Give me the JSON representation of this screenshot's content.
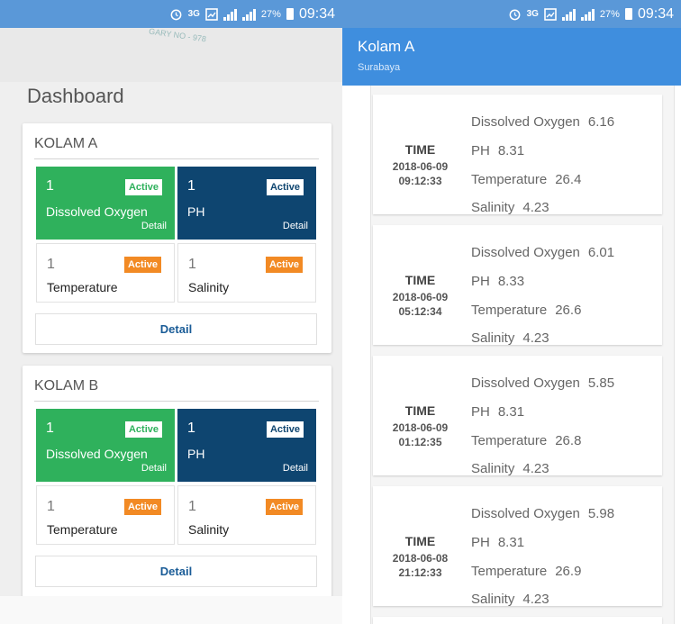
{
  "status_bar": {
    "left": {
      "network": "3G",
      "battery": "27%",
      "time": "09:34"
    },
    "right": {
      "network": "3G",
      "battery": "27%",
      "time": "09:34"
    }
  },
  "left_screen": {
    "watermark": "GARY NO - 978",
    "dashboard_title": "Dashboard",
    "ponds": [
      {
        "name": "KOLAM A",
        "tiles": [
          {
            "count": "1",
            "badge": "Active",
            "label": "Dissolved Oxygen",
            "detail": "Detail"
          },
          {
            "count": "1",
            "badge": "Active",
            "label": "PH",
            "detail": "Detail"
          },
          {
            "count": "1",
            "badge": "Active",
            "label": "Temperature"
          },
          {
            "count": "1",
            "badge": "Active",
            "label": "Salinity"
          }
        ],
        "detail_button": "Detail"
      },
      {
        "name": "KOLAM B",
        "tiles": [
          {
            "count": "1",
            "badge": "Active",
            "label": "Dissolved Oxygen",
            "detail": "Detail"
          },
          {
            "count": "1",
            "badge": "Active",
            "label": "PH",
            "detail": "Detail"
          },
          {
            "count": "1",
            "badge": "Active",
            "label": "Temperature"
          },
          {
            "count": "1",
            "badge": "Active",
            "label": "Salinity"
          }
        ],
        "detail_button": "Detail"
      }
    ]
  },
  "right_screen": {
    "title": "Kolam A",
    "subtitle": "Surabaya",
    "readings": [
      {
        "time_label": "TIME",
        "date": "2018-06-09",
        "time": "09:12:33",
        "metrics": [
          {
            "name": "Dissolved Oxygen",
            "value": "6.16"
          },
          {
            "name": "PH",
            "value": "8.31"
          },
          {
            "name": "Temperature",
            "value": "26.4"
          },
          {
            "name": "Salinity",
            "value": "4.23"
          }
        ]
      },
      {
        "time_label": "TIME",
        "date": "2018-06-09",
        "time": "05:12:34",
        "metrics": [
          {
            "name": "Dissolved Oxygen",
            "value": "6.01"
          },
          {
            "name": "PH",
            "value": "8.33"
          },
          {
            "name": "Temperature",
            "value": "26.6"
          },
          {
            "name": "Salinity",
            "value": "4.23"
          }
        ]
      },
      {
        "time_label": "TIME",
        "date": "2018-06-09",
        "time": "01:12:35",
        "metrics": [
          {
            "name": "Dissolved Oxygen",
            "value": "5.85"
          },
          {
            "name": "PH",
            "value": "8.31"
          },
          {
            "name": "Temperature",
            "value": "26.8"
          },
          {
            "name": "Salinity",
            "value": "4.23"
          }
        ]
      },
      {
        "time_label": "TIME",
        "date": "2018-06-08",
        "time": "21:12:33",
        "metrics": [
          {
            "name": "Dissolved Oxygen",
            "value": "5.98"
          },
          {
            "name": "PH",
            "value": "8.31"
          },
          {
            "name": "Temperature",
            "value": "26.9"
          },
          {
            "name": "Salinity",
            "value": "4.23"
          }
        ]
      }
    ]
  },
  "colors": {
    "status_bar": "#5a98d8",
    "app_bar": "#3f8ede",
    "dissolved_oxygen_tile": "#2fb15c",
    "ph_tile": "#0e4570",
    "active_badge": "#f28a24",
    "detail_link": "#1a5c97"
  }
}
